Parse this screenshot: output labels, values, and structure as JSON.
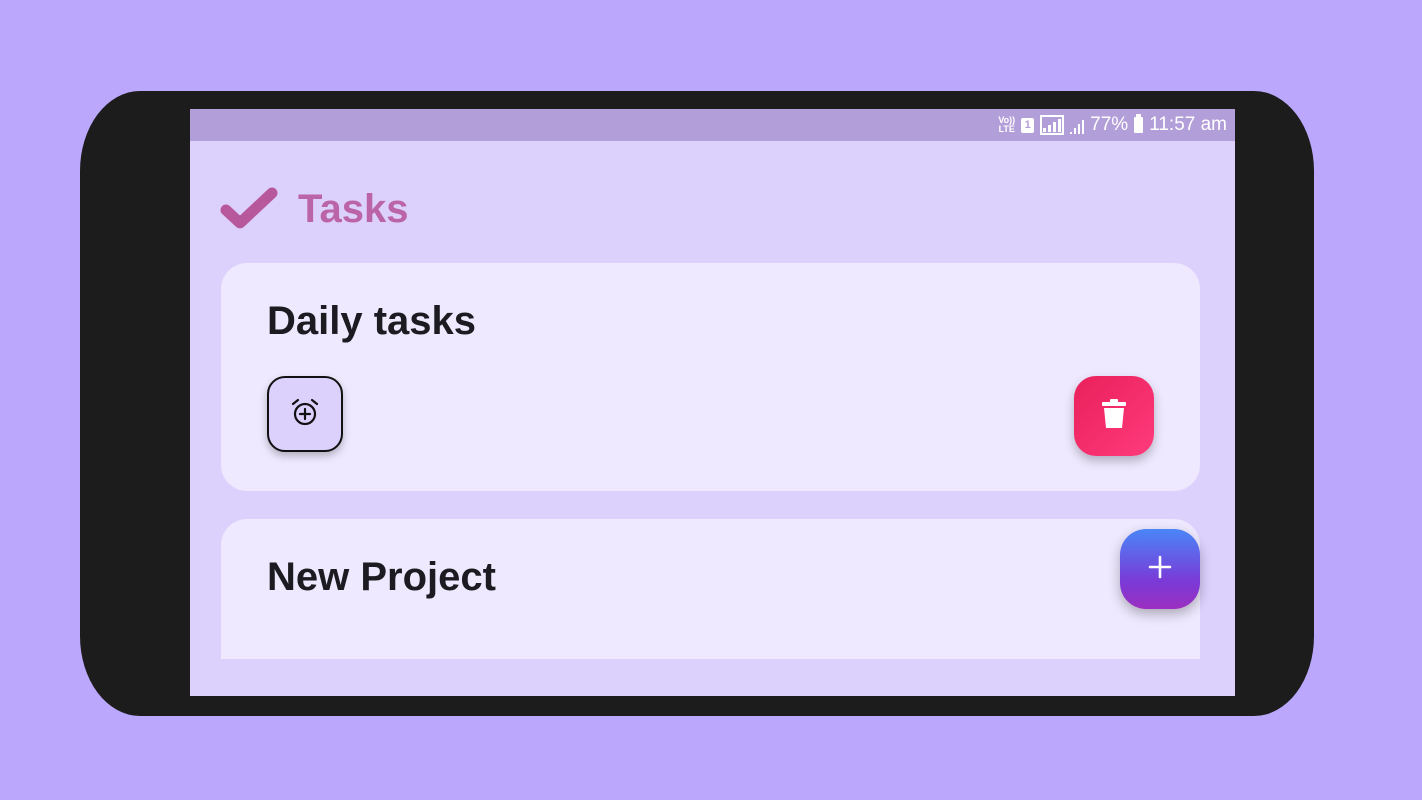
{
  "status_bar": {
    "volte": "Vo)) LTE",
    "sim": "1",
    "battery_percent": "77%",
    "time": "11:57 am"
  },
  "header": {
    "icon": "check-icon",
    "title": "Tasks"
  },
  "projects": [
    {
      "title": "Daily tasks",
      "actions": [
        "add-alarm-icon",
        "trash-icon"
      ]
    },
    {
      "title": "New Project"
    }
  ],
  "fab": {
    "icon": "plus-icon"
  },
  "colors": {
    "background": "#bba8fc",
    "screen": "#dcd0fd",
    "card": "#eee9fe",
    "title_accent": "#bb64a7",
    "delete": "#f02a68",
    "fab_top": "#4a86f7",
    "fab_bottom": "#9b2fc0"
  }
}
